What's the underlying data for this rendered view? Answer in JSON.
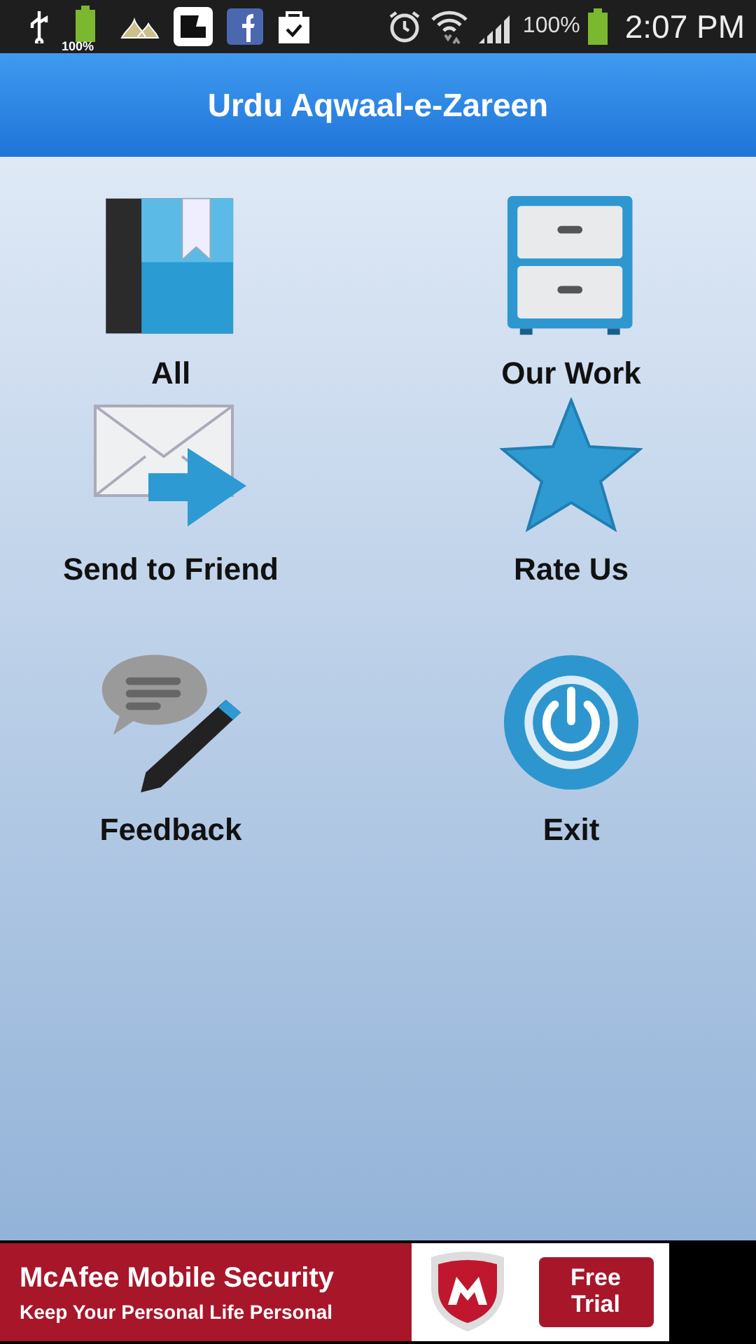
{
  "status_bar": {
    "battery_badge": "100%",
    "battery_text": "100%",
    "time": "2:07 PM"
  },
  "title_bar": {
    "title": "Urdu Aqwaal-e-Zareen"
  },
  "menu": [
    {
      "label": "All",
      "kind": "book"
    },
    {
      "label": "Our Work",
      "kind": "cabinet"
    },
    {
      "label": "Send to Friend",
      "kind": "mail"
    },
    {
      "label": "Rate Us",
      "kind": "star"
    },
    {
      "label": "Feedback",
      "kind": "chat"
    },
    {
      "label": "Exit",
      "kind": "power"
    }
  ],
  "ad": {
    "headline": "McAfee Mobile Security",
    "tagline": "Keep Your Personal Life Personal",
    "button": "Free Trial"
  }
}
